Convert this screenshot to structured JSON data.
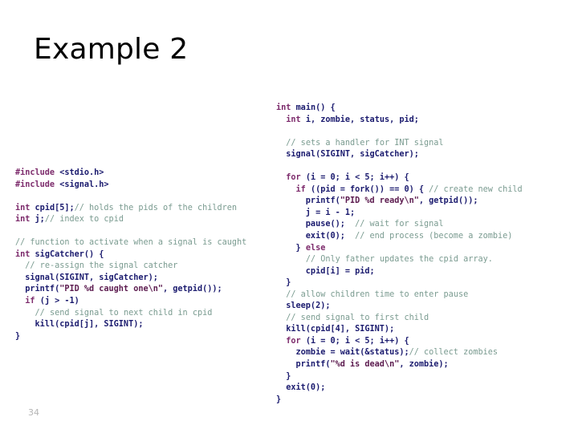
{
  "slide": {
    "title": "Example 2",
    "page_number": "34",
    "background_color": "#ffffff"
  },
  "colors": {
    "keyword": "#7c2a6b",
    "identifier": "#1a1a6e",
    "comment": "#7a9b90",
    "string": "#5b1a4e",
    "title": "#000000",
    "page_number": "#b5b5b5"
  },
  "code_left": {
    "language": "c",
    "lines": [
      [
        {
          "t": "#include ",
          "c": "kw"
        },
        {
          "t": "<stdio.h>",
          "c": "id"
        }
      ],
      [
        {
          "t": "#include ",
          "c": "kw"
        },
        {
          "t": "<signal.h>",
          "c": "id"
        }
      ],
      [
        {
          "t": "",
          "c": "pl"
        }
      ],
      [
        {
          "t": "int ",
          "c": "kw"
        },
        {
          "t": "cpid[5];",
          "c": "id"
        },
        {
          "t": "// holds the pids of the children",
          "c": "cm"
        }
      ],
      [
        {
          "t": "int ",
          "c": "kw"
        },
        {
          "t": "j;",
          "c": "id"
        },
        {
          "t": "// index to cpid",
          "c": "cm"
        }
      ],
      [
        {
          "t": "",
          "c": "pl"
        }
      ],
      [
        {
          "t": "// function to activate when a signal is caught",
          "c": "cm"
        }
      ],
      [
        {
          "t": "int ",
          "c": "kw"
        },
        {
          "t": "sigCatcher() {",
          "c": "id"
        }
      ],
      [
        {
          "t": "  ",
          "c": "pl"
        },
        {
          "t": "// re-assign the signal catcher",
          "c": "cm"
        }
      ],
      [
        {
          "t": "  signal(SIGINT, sigCatcher);",
          "c": "id"
        }
      ],
      [
        {
          "t": "  printf(",
          "c": "id"
        },
        {
          "t": "\"PID %d caught one\\n\"",
          "c": "str"
        },
        {
          "t": ", getpid());",
          "c": "id"
        }
      ],
      [
        {
          "t": "  ",
          "c": "pl"
        },
        {
          "t": "if ",
          "c": "kw"
        },
        {
          "t": "(j > -1)",
          "c": "id"
        }
      ],
      [
        {
          "t": "    ",
          "c": "pl"
        },
        {
          "t": "// send signal to next child in cpid",
          "c": "cm"
        }
      ],
      [
        {
          "t": "    kill(cpid[j], SIGINT);",
          "c": "id"
        }
      ],
      [
        {
          "t": "}",
          "c": "id"
        }
      ]
    ]
  },
  "code_right": {
    "language": "c",
    "lines": [
      [
        {
          "t": "int ",
          "c": "kw"
        },
        {
          "t": "main() {",
          "c": "id"
        }
      ],
      [
        {
          "t": "  ",
          "c": "pl"
        },
        {
          "t": "int ",
          "c": "kw"
        },
        {
          "t": "i, zombie, status, pid;",
          "c": "id"
        }
      ],
      [
        {
          "t": "",
          "c": "pl"
        }
      ],
      [
        {
          "t": "  ",
          "c": "pl"
        },
        {
          "t": "// sets a handler for INT signal",
          "c": "cm"
        }
      ],
      [
        {
          "t": "  signal(SIGINT, sigCatcher);",
          "c": "id"
        }
      ],
      [
        {
          "t": "",
          "c": "pl"
        }
      ],
      [
        {
          "t": "  ",
          "c": "pl"
        },
        {
          "t": "for ",
          "c": "kw"
        },
        {
          "t": "(i = 0; i < 5; i++) {",
          "c": "id"
        }
      ],
      [
        {
          "t": "    ",
          "c": "pl"
        },
        {
          "t": "if ",
          "c": "kw"
        },
        {
          "t": "((pid = fork()) == 0) { ",
          "c": "id"
        },
        {
          "t": "// create new child",
          "c": "cm"
        }
      ],
      [
        {
          "t": "      printf(",
          "c": "id"
        },
        {
          "t": "\"PID %d ready\\n\"",
          "c": "str"
        },
        {
          "t": ", getpid());",
          "c": "id"
        }
      ],
      [
        {
          "t": "      j = i - 1;",
          "c": "id"
        }
      ],
      [
        {
          "t": "      pause();  ",
          "c": "id"
        },
        {
          "t": "// wait for signal",
          "c": "cm"
        }
      ],
      [
        {
          "t": "      exit(0);  ",
          "c": "id"
        },
        {
          "t": "// end process (become a zombie)",
          "c": "cm"
        }
      ],
      [
        {
          "t": "    } ",
          "c": "id"
        },
        {
          "t": "else",
          "c": "kw"
        }
      ],
      [
        {
          "t": "      ",
          "c": "pl"
        },
        {
          "t": "// Only father updates the cpid array.",
          "c": "cm"
        }
      ],
      [
        {
          "t": "      cpid[i] = pid;",
          "c": "id"
        }
      ],
      [
        {
          "t": "  }",
          "c": "id"
        }
      ],
      [
        {
          "t": "  ",
          "c": "pl"
        },
        {
          "t": "// allow children time to enter pause",
          "c": "cm"
        }
      ],
      [
        {
          "t": "  sleep(2);",
          "c": "id"
        }
      ],
      [
        {
          "t": "  ",
          "c": "pl"
        },
        {
          "t": "// send signal to first child",
          "c": "cm"
        }
      ],
      [
        {
          "t": "  kill(cpid[4], SIGINT);",
          "c": "id"
        }
      ],
      [
        {
          "t": "  ",
          "c": "pl"
        },
        {
          "t": "for ",
          "c": "kw"
        },
        {
          "t": "(i = 0; i < 5; i++) {",
          "c": "id"
        }
      ],
      [
        {
          "t": "    zombie = wait(&status);",
          "c": "id"
        },
        {
          "t": "// collect zombies",
          "c": "cm"
        }
      ],
      [
        {
          "t": "    printf(",
          "c": "id"
        },
        {
          "t": "\"%d is dead\\n\"",
          "c": "str"
        },
        {
          "t": ", zombie);",
          "c": "id"
        }
      ],
      [
        {
          "t": "  }",
          "c": "id"
        }
      ],
      [
        {
          "t": "  exit(0);",
          "c": "id"
        }
      ],
      [
        {
          "t": "}",
          "c": "id"
        }
      ]
    ]
  }
}
